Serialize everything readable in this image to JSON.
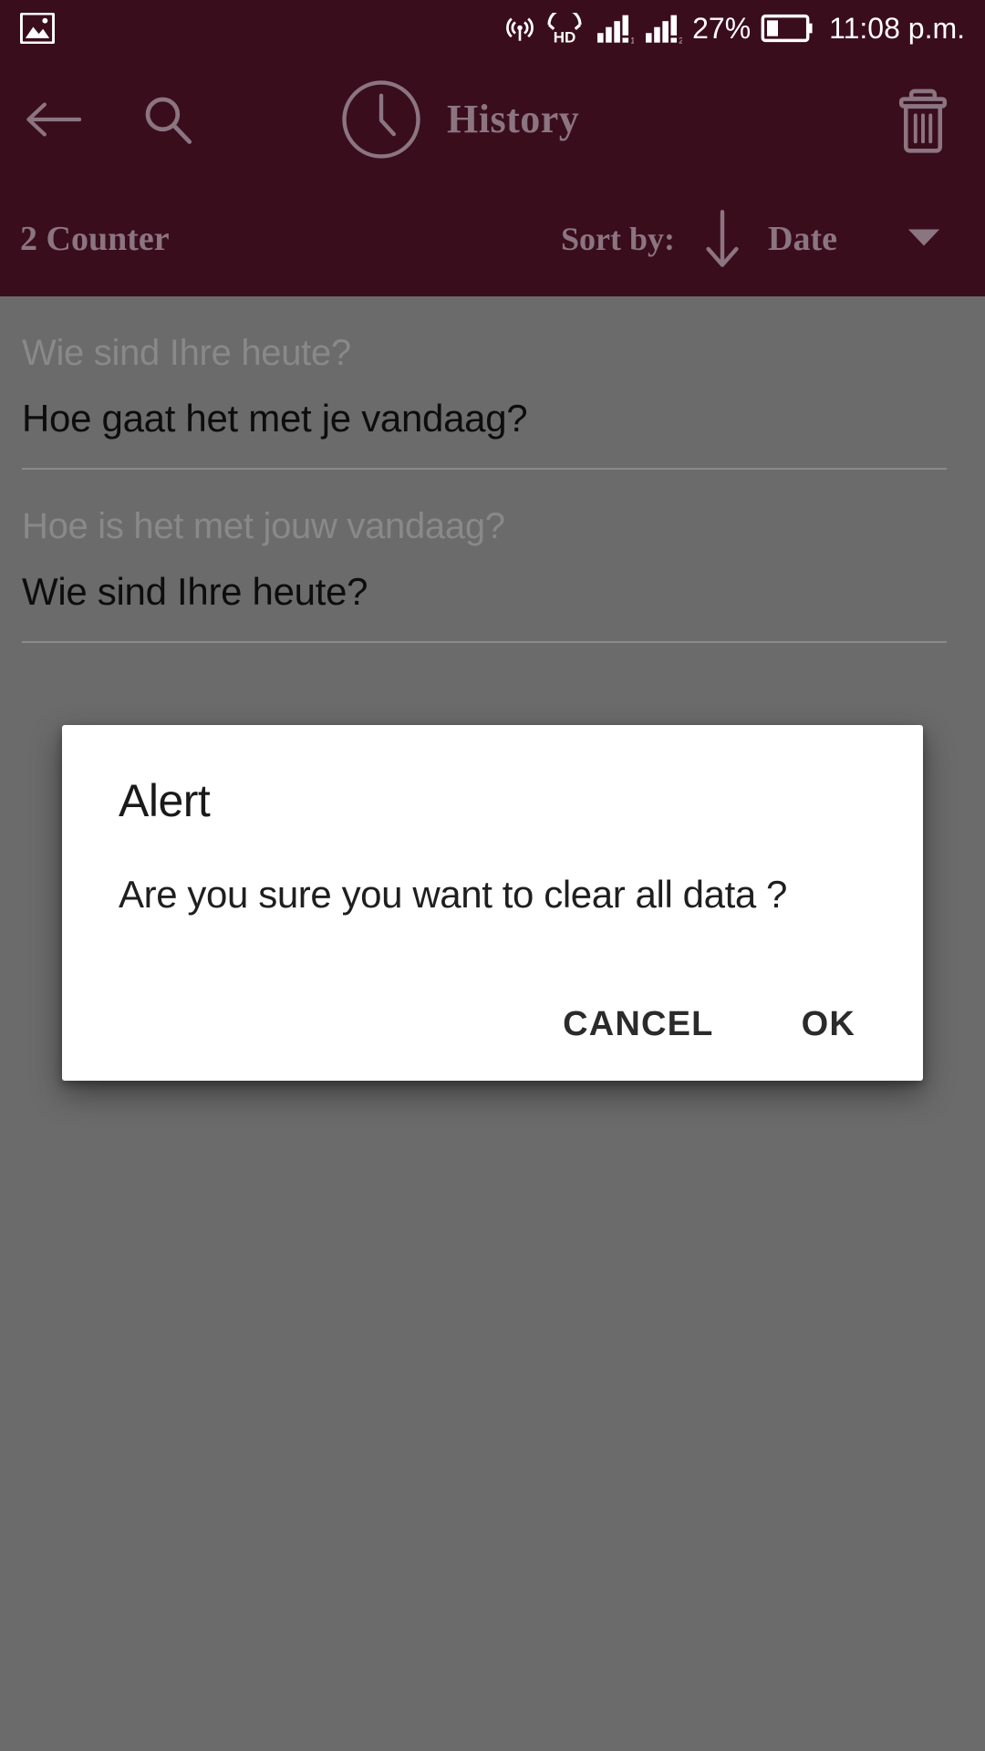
{
  "status_bar": {
    "left_icon": "image-photo-icon",
    "icons": [
      "hotspot-icon",
      "hd-voice-icon",
      "signal-sim1-icon",
      "signal-sim2-icon"
    ],
    "battery_percent": "27%",
    "battery_icon": "battery-low-icon",
    "time": "11:08 p.m."
  },
  "app_bar": {
    "back_icon": "back-arrow-icon",
    "search_icon": "search-icon",
    "clock_icon": "clock-icon",
    "title": "History",
    "delete_icon": "trash-icon"
  },
  "sort_bar": {
    "counter": "2 Counter",
    "sort_label": "Sort by:",
    "direction_icon": "arrow-down-icon",
    "sort_value": "Date",
    "dropdown_icon": "caret-down-icon"
  },
  "history": {
    "items": [
      {
        "source": "Wie sind Ihre heute?",
        "translation": "Hoe gaat het met je vandaag?"
      },
      {
        "source": "Hoe is het met jouw vandaag?",
        "translation": "Wie sind Ihre heute?"
      }
    ]
  },
  "dialog": {
    "title": "Alert",
    "message": "Are you sure you want to clear all data ?",
    "cancel_label": "CANCEL",
    "ok_label": "OK"
  },
  "colors": {
    "header_bg": "#3a0d1c",
    "header_text": "#8b7580",
    "content_bg": "#6b6b6b",
    "dialog_bg": "#ffffff",
    "primary_text": "#0d0d0d",
    "secondary_text": "#898989"
  }
}
